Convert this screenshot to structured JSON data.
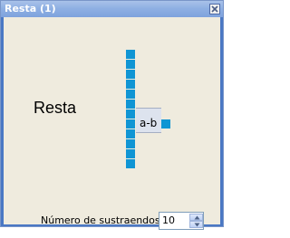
{
  "window": {
    "title": "Resta (1)",
    "close_icon": "close-icon"
  },
  "block": {
    "label": "Resta",
    "operator_text": "a-b",
    "input_count": 10
  },
  "parameter": {
    "label": "Número de sustraendos:",
    "value": "10",
    "up_icon": "arrow-up-icon",
    "down_icon": "arrow-down-icon"
  },
  "colors": {
    "port": "#0f95d4",
    "titlebar": "#8fb0e3",
    "client_bg": "#efebde"
  }
}
